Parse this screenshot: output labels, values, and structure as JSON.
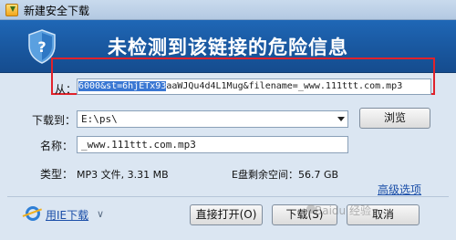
{
  "window": {
    "title": "新建安全下载"
  },
  "banner": {
    "title": "未检测到该链接的危险信息"
  },
  "url": {
    "label": "从：",
    "selected_text": "6000&st=6hjETx93",
    "rest_text": "aaWJQu4d4L1Mug&filename=_www.111ttt.com.mp3"
  },
  "save_to": {
    "label": "下载到：",
    "value": "E:\\ps\\",
    "browse_label": "浏览"
  },
  "name": {
    "label": "名称：",
    "value": "_www.111ttt.com.mp3"
  },
  "type": {
    "label": "类型：",
    "value": "MP3 文件, 3.31 MB"
  },
  "disk": {
    "text": "E盘剩余空间：56.7 GB"
  },
  "advanced": {
    "label": "高级选项"
  },
  "footer": {
    "ie_label": "用IE下载",
    "open_label": "直接打开(O)",
    "download_label": "下载(S)",
    "cancel_label": "取消",
    "watermark": "Baidu 经验"
  },
  "colors": {
    "banner": "#1a5aa3",
    "highlight_box": "#e0222b",
    "selection": "#3a77d3",
    "link": "#1a4ea8"
  },
  "icons": [
    "app-icon",
    "shield-icon",
    "ie-icon",
    "chevron-down-icon",
    "dropdown-arrow-icon"
  ]
}
